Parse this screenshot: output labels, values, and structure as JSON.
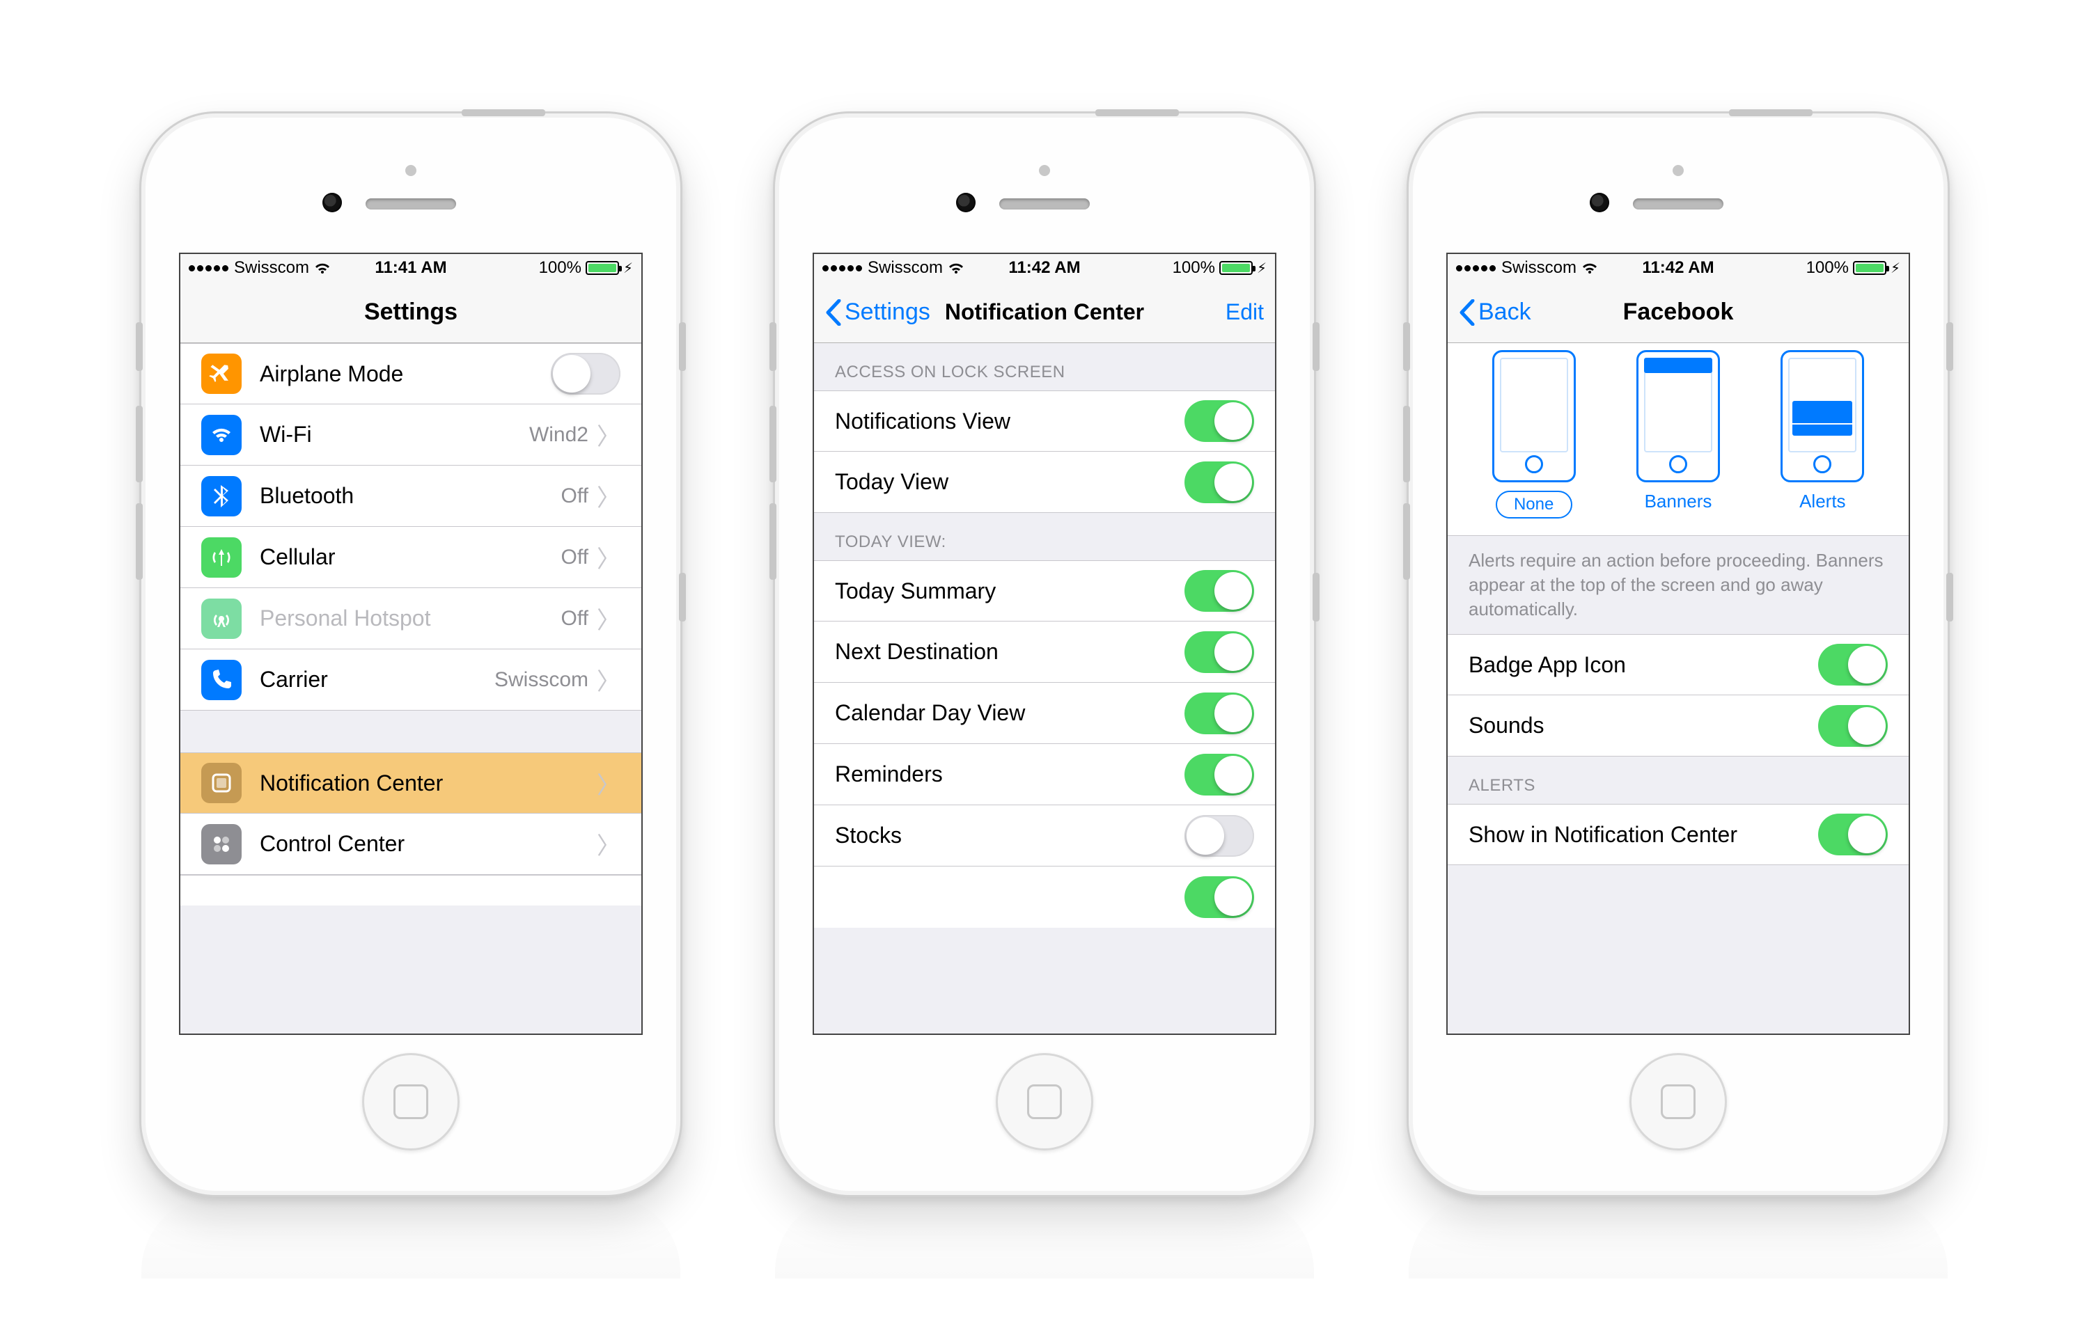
{
  "status": {
    "carrier": "Swisscom",
    "battery_text": "100%",
    "times": [
      "11:41 AM",
      "11:42 AM",
      "11:42 AM"
    ]
  },
  "screen1": {
    "title": "Settings",
    "rows": [
      {
        "icon": "airplane",
        "color": "#ff9500",
        "label": "Airplane Mode",
        "value": "",
        "accessory": "toggle",
        "on": false
      },
      {
        "icon": "wifi",
        "color": "#007aff",
        "label": "Wi-Fi",
        "value": "Wind2",
        "accessory": "chev"
      },
      {
        "icon": "bluetooth",
        "color": "#007aff",
        "label": "Bluetooth",
        "value": "Off",
        "accessory": "chev"
      },
      {
        "icon": "cellular",
        "color": "#4cd964",
        "label": "Cellular",
        "value": "Off",
        "accessory": "chev"
      },
      {
        "icon": "hotspot",
        "color": "#7ddda3",
        "label": "Personal Hotspot",
        "value": "Off",
        "accessory": "chev",
        "disabled": true
      },
      {
        "icon": "phone",
        "color": "#007aff",
        "label": "Carrier",
        "value": "Swisscom",
        "accessory": "chev"
      }
    ],
    "rows2": [
      {
        "icon": "notif",
        "color": "#c59a53",
        "label": "Notification Center",
        "accessory": "chev",
        "highlight": true
      },
      {
        "icon": "control",
        "color": "#8e8e93",
        "label": "Control Center",
        "accessory": "chev"
      }
    ]
  },
  "screen2": {
    "back": "Settings",
    "title": "Notification Center",
    "edit": "Edit",
    "section1_header": "ACCESS ON LOCK SCREEN",
    "section1": [
      {
        "label": "Notifications View",
        "on": true
      },
      {
        "label": "Today View",
        "on": true
      }
    ],
    "section2_header": "TODAY VIEW:",
    "section2": [
      {
        "label": "Today Summary",
        "on": true
      },
      {
        "label": "Next Destination",
        "on": true
      },
      {
        "label": "Calendar Day View",
        "on": true
      },
      {
        "label": "Reminders",
        "on": true
      },
      {
        "label": "Stocks",
        "on": false
      }
    ]
  },
  "screen3": {
    "back": "Back",
    "title": "Facebook",
    "picker_options": [
      "None",
      "Banners",
      "Alerts"
    ],
    "picker_selected": 0,
    "picker_footer": "Alerts require an action before proceeding. Banners appear at the top of the screen and go away automatically.",
    "rows": [
      {
        "label": "Badge App Icon",
        "on": true
      },
      {
        "label": "Sounds",
        "on": true
      }
    ],
    "alerts_header": "ALERTS",
    "alerts_rows": [
      {
        "label": "Show in Notification Center",
        "on": true
      }
    ]
  }
}
